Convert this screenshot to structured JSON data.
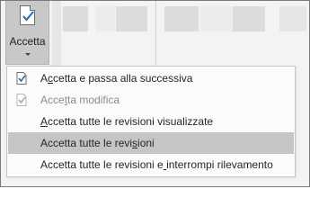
{
  "ribbon": {
    "accept_button": {
      "label": "Accetta"
    }
  },
  "menu": {
    "items": [
      {
        "label": "Accetta e passa alla successiva",
        "underline_index": 1,
        "icon": "accept-next-icon",
        "state": "normal"
      },
      {
        "label": "Accetta modifica",
        "underline_index": 4,
        "icon": "accept-change-icon",
        "state": "disabled"
      },
      {
        "label": "Accetta tutte le revisioni visualizzate",
        "underline_index": 0,
        "icon": "",
        "state": "normal"
      },
      {
        "label": "Accetta tutte le revisioni",
        "underline_index": 21,
        "icon": "",
        "state": "highlighted"
      },
      {
        "label": "Accetta tutte le revisioni e interrompi rilevamento",
        "underline_index": 28,
        "icon": "",
        "state": "normal"
      }
    ]
  },
  "colors": {
    "highlight": "#c5c5c5",
    "check": "#1e6bb8",
    "disabled_text": "#8a8a8a"
  }
}
